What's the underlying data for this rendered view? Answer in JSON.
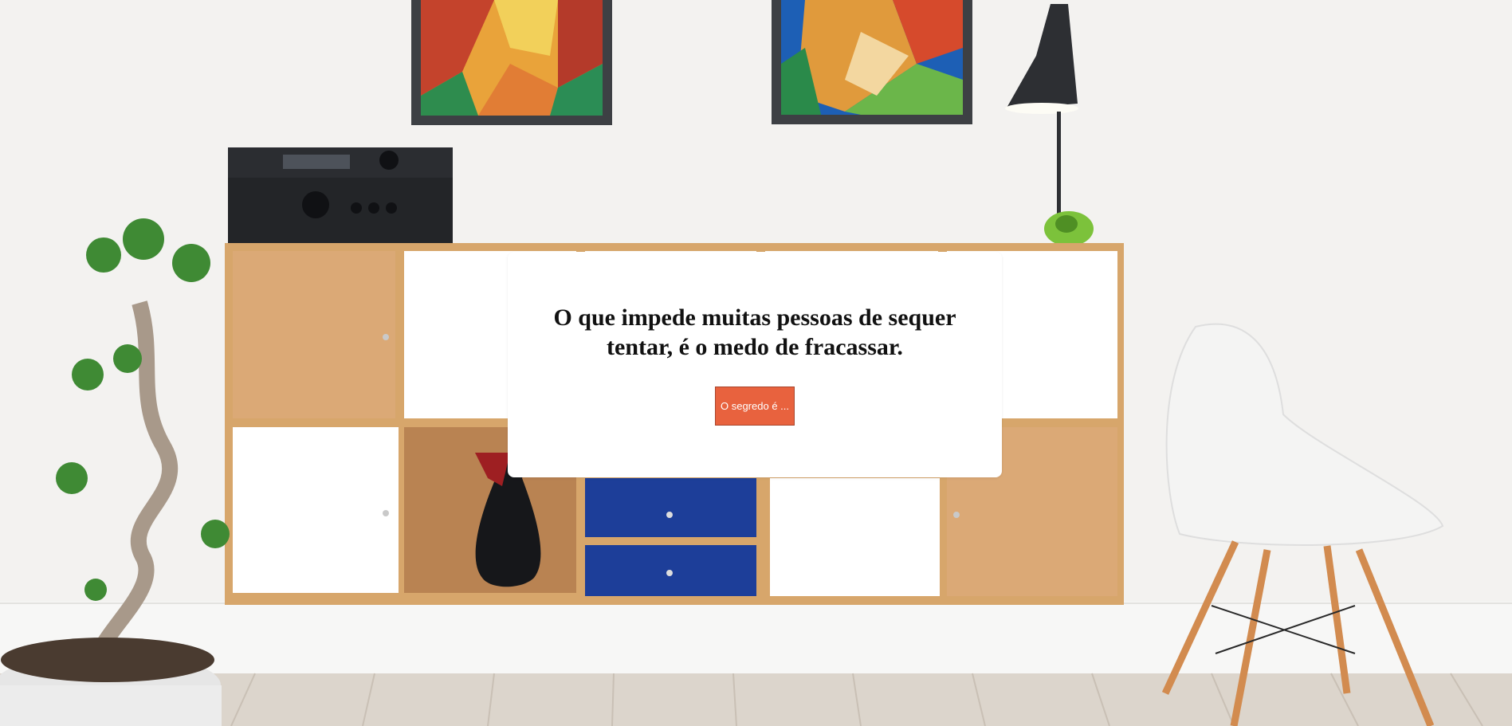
{
  "background": {
    "description_icon": "living-room-photo",
    "wall_color": "#f2f1ef",
    "floor_color": "#d9d2c9"
  },
  "modal": {
    "quote": "O que impede muitas pessoas de sequer tentar, é o medo de fracassar.",
    "button_label": "O segredo é ...",
    "button_color": "#e8623e"
  }
}
